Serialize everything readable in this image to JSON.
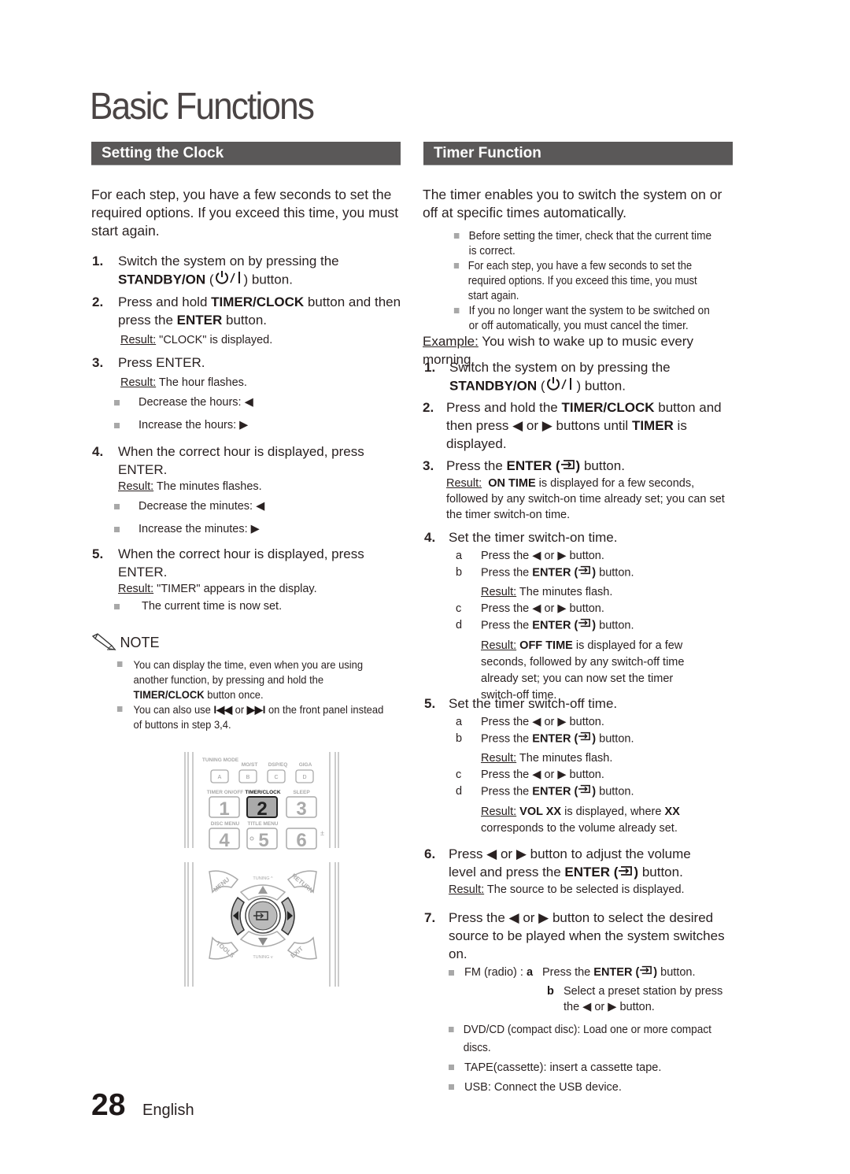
{
  "page_title": "Basic Functions",
  "left": {
    "header": "Setting the Clock",
    "intro": "For each step, you have a few seconds to set the required options. If you exceed this time, you must start again.",
    "steps": [
      {
        "num": "1.",
        "pre": "Switch the system on by pressing the",
        "bold": "STANDBY/ON",
        "post": " button."
      },
      {
        "num": "2.",
        "pre": "Press and hold ",
        "bold": "TIMER/CLOCK",
        "mid": " button and then press the ",
        "bold2": "ENTER",
        "post": " button.",
        "result_label": "Result:",
        "result": " \"CLOCK\" is displayed."
      },
      {
        "num": "3.",
        "text": "Press ENTER.",
        "result_label": "Result:",
        "result": " The hour flashes.",
        "bullets": [
          "Decrease the hours: ◀",
          "Increase the hours: ▶"
        ]
      },
      {
        "num": "4.",
        "text": "When the correct hour is displayed, press ENTER.",
        "result_label": "Result:",
        "result": " The minutes flashes.",
        "bullets": [
          "Decrease the minutes: ◀",
          "Increase the minutes: ▶"
        ]
      },
      {
        "num": "5.",
        "text": "When the correct hour is displayed, press ENTER.",
        "result_label": "Result:",
        "result": " \"TIMER\" appears in the display.",
        "bullets": [
          "The current time is now set."
        ]
      }
    ],
    "note": {
      "label": "NOTE",
      "items": [
        {
          "pre": "You can display the time, even when you are using another function, by pressing and hold the ",
          "bold": "TIMER/CLOCK",
          "post": " button once."
        },
        {
          "pre": "You can also use ",
          "bold": "I◀◀",
          "mid": " or ",
          "bold2": "▶▶I",
          "post": " on the front panel instead of buttons in step 3,4."
        }
      ]
    },
    "remote": {
      "row_labels_1": [
        "TUNING MODE",
        "MO/ST",
        "DSP/EQ",
        "GIGA"
      ],
      "row_keys_1": [
        "A",
        "B",
        "C",
        "D"
      ],
      "row_labels_2": [
        "TIMER ON/OFF",
        "TIMER/CLOCK",
        "SLEEP"
      ],
      "row_keys_2": [
        "1",
        "2",
        "3"
      ],
      "row_labels_3": [
        "DISC MENU",
        "TITLE MENU"
      ],
      "row_keys_3": [
        "4",
        "5",
        "6"
      ],
      "nav_labels": {
        "menu": "MENU",
        "return": "RETURN",
        "tools": "TOOLS",
        "exit": "EXIT",
        "tuning_up": "TUNING ^",
        "tuning_down": "TUNING v"
      }
    }
  },
  "right": {
    "header": "Timer Function",
    "intro": "The timer enables you to switch the system on or off at specific times automatically.",
    "bullets": [
      "Before setting the timer, check that the current time is correct.",
      "For each step, you have a few seconds to set the required options. If you exceed this time, you must start again.",
      "If you no longer want the system to be switched on or off automatically, you must cancel the timer."
    ],
    "example_label": "Example:",
    "example": " You wish to wake up to music every morning.",
    "step1": {
      "num": "1.",
      "pre": "Switch the system on by pressing the",
      "bold": "STANDBY/ON",
      "post": " button."
    },
    "step2": {
      "num": "2.",
      "pre": "Press and hold the ",
      "bold": "TIMER/CLOCK",
      "mid": " button and then press ◀ or ▶ buttons until ",
      "bold2": "TIMER",
      "post": " is displayed."
    },
    "step3": {
      "num": "3.",
      "pre": "Press the ",
      "bold": "ENTER (",
      "post": " button.",
      "result_label": "Result:",
      "result_bold": "ON TIME",
      "result": " is displayed for a few seconds, followed by any switch-on time already set; you can set the timer switch-on time."
    },
    "step4": {
      "num": "4.",
      "text": "Set the timer switch-on time.",
      "a": "Press the ◀ or ▶ button.",
      "b_pre": "Press the ",
      "b_bold": "ENTER (",
      "b_post": " button.",
      "b_result_label": "Result:",
      "b_result": " The minutes flash.",
      "c": "Press the ◀ or ▶ button.",
      "d_pre": "Press the ",
      "d_bold": "ENTER (",
      "d_post": " button.",
      "d_result_label": "Result:",
      "d_result_bold": "OFF TIME",
      "d_result": " is displayed for a few seconds, followed by any switch-off time already set; you can now set the timer switch-off time."
    },
    "step5": {
      "num": "5.",
      "text": "Set the timer switch-off time.",
      "a": "Press the ◀ or ▶ button.",
      "b_pre": "Press the ",
      "b_bold": "ENTER (",
      "b_post": " button.",
      "b_result_label": "Result:",
      "b_result": " The minutes flash.",
      "c": "Press the  ◀ or ▶ button.",
      "d_pre": "Press the ",
      "d_bold": "ENTER (",
      "d_post": " button.",
      "d_result_label": "Result:",
      "d_result_bold": "VOL XX",
      "d_result_mid": " is displayed, where ",
      "d_result_bold2": "XX",
      "d_result": " corresponds to the volume already set."
    },
    "step6": {
      "num": "6.",
      "pre": "Press ◀ or ▶ button to adjust the volume level and press the ",
      "bold": "ENTER (",
      "post": " button.",
      "result_label": "Result:",
      "result": " The source to be selected is displayed."
    },
    "step7": {
      "num": "7.",
      "text": "Press the ◀ or ▶ button to select the desired source to be played when the system switches on.",
      "fm_label": "FM (radio) : ",
      "fm_a": "a",
      "fm_a_pre": "Press the ",
      "fm_a_bold": "ENTER (",
      "fm_a_post": " button.",
      "fm_b": "b",
      "fm_b_text": "Select a preset station by press the  ◀ or ▶ button.",
      "others": [
        "DVD/CD (compact disc): Load one or more compact discs.",
        "TAPE(cassette): insert a cassette tape.",
        "USB: Connect the USB device."
      ]
    }
  },
  "footer": {
    "page_number": "28",
    "language": "English"
  }
}
